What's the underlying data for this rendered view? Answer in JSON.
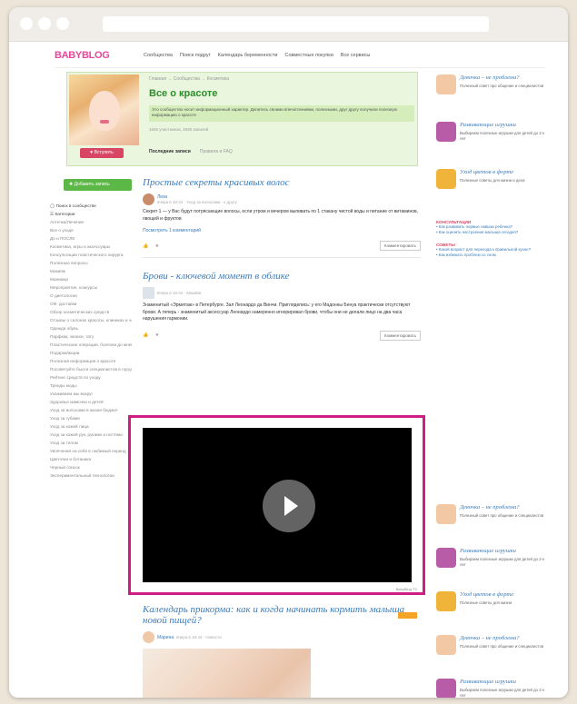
{
  "header": {
    "logo": "BABYBLOG",
    "nav": [
      "Сообщества",
      "Поиск подруг",
      "Календарь беременности",
      "Совместные покупки",
      "Все сервисы"
    ]
  },
  "community": {
    "breadcrumb": "Главная → Сообщества → Косметика",
    "title": "Все о красоте",
    "description": "Это сообщество носит информационный характер. Делитесь своими впечатлениями, полезными, друг другу получили полезную информацию о красоте",
    "stats": "1845 участников, 4836 записей",
    "join": "Вступить",
    "tabs": [
      "Последние записи",
      "Правила и FAQ"
    ]
  },
  "add_post": "Добавить запись",
  "sidebar": [
    "Поиск в сообществе",
    "Категории",
    "Аптечка/Лечение",
    "Все о уходе",
    "До и ПОСЛЕ",
    "Косметика, игры и аксессуары",
    "Консультации пластического хирурга",
    "Полезные вопросы",
    "Макияж",
    "Маникюр",
    "Мероприятия, конкурсы",
    "О диетологии",
    "ОФ. доставки",
    "Обзор косметических средств",
    "Отзывы о салонах красоты, клиниках и частных мастерах",
    "Одежда обувь",
    "Парфюм, запахи, тату",
    "Пластические операции, болезни до мнения",
    "Подарки/акции",
    "Полезная информация о красоте",
    "Посоветуйте бьюти специалистов в городе",
    "Рейтинг средств по уходу",
    "Тренды моды",
    "Ухаживаем мы вокруг",
    "Здоровье мамочки и детей",
    "Уход за волосами в жизни бюджет",
    "Уход за губами",
    "Уход за кожей лица",
    "Уход за кожей рук, руками и ногтями",
    "Уход за телом",
    "Увлечения на себя в любимый период",
    "Цветочки и ботаника",
    "Черный список",
    "Экспериментальный технологии"
  ],
  "posts": [
    {
      "title": "Простые секреты красивых волос",
      "author": "Лиза",
      "meta": "вчера в 18:44 · Уход за волосами · к другу",
      "excerpt": "Секрет 1 — у Вас будут потрясающие волосы, если утром и вечером выпивать по 1 стакану чистой воды и питание от витаминов, овощей и фруктов",
      "link": "Посмотреть 1 комментарий",
      "comment": "Комментировать"
    },
    {
      "title": "Брови - ключевой момент в облике",
      "meta": "вчера в 18:44 · Макияж",
      "excerpt": "Знаменитый «Эрмитаж» в Петербурге. Зал Леонардо да Винчи. Пригляделись: у его Мадонны Бенуа практически отсутствуют брови. А теперь - знаменитый аксессуар Леонардо намеренно игнорировал брови, чтобы они не делали лицо на два часа нарушения гармонии.",
      "comment": "Комментировать"
    },
    {
      "title": "Календарь прикорма: как и когда начинать кормить малыша новой пищей?",
      "author": "Марина",
      "meta": "вчера в 18:44 · Новости"
    }
  ],
  "video": {
    "caption": "BabyBlog TV"
  },
  "widgets": [
    {
      "title": "Девочка – не проблема?",
      "text": "Полезный совет про общение и специалистов"
    },
    {
      "title": "Развивающие игрушки",
      "text": "Выбираем полезные игрушки для детей до 2-х лет"
    },
    {
      "title": "Уход цветов в форте",
      "text": "Полезные советы для жизни и дела"
    }
  ],
  "consult": {
    "head": "КОНСУЛЬТАЦИИ",
    "links": [
      "Как развивать первые навыки ребенка?",
      "Как оценить настроения малыша сегодня?"
    ]
  },
  "tips": {
    "head": "СОВЕТЫ",
    "links": [
      "Какой возраст для перехода к правильной кухне?",
      "Как избежать проблем со сном"
    ]
  },
  "widgets2": [
    {
      "title": "Девочка – не проблема?",
      "text": "Полезный совет про общение и специалистов"
    },
    {
      "title": "Развивающие игрушки",
      "text": "Выбираем полезные игрушки для детей до 2-х лет"
    },
    {
      "title": "Уход цветов в форте",
      "text": "Полезные советы для жизни"
    },
    {
      "title": "Девочка – не проблема?",
      "text": "Полезный совет про общение и специалистов"
    },
    {
      "title": "Развивающие игрушки",
      "text": "Выбираем полезные игрушки для детей до 2-х лет"
    }
  ]
}
